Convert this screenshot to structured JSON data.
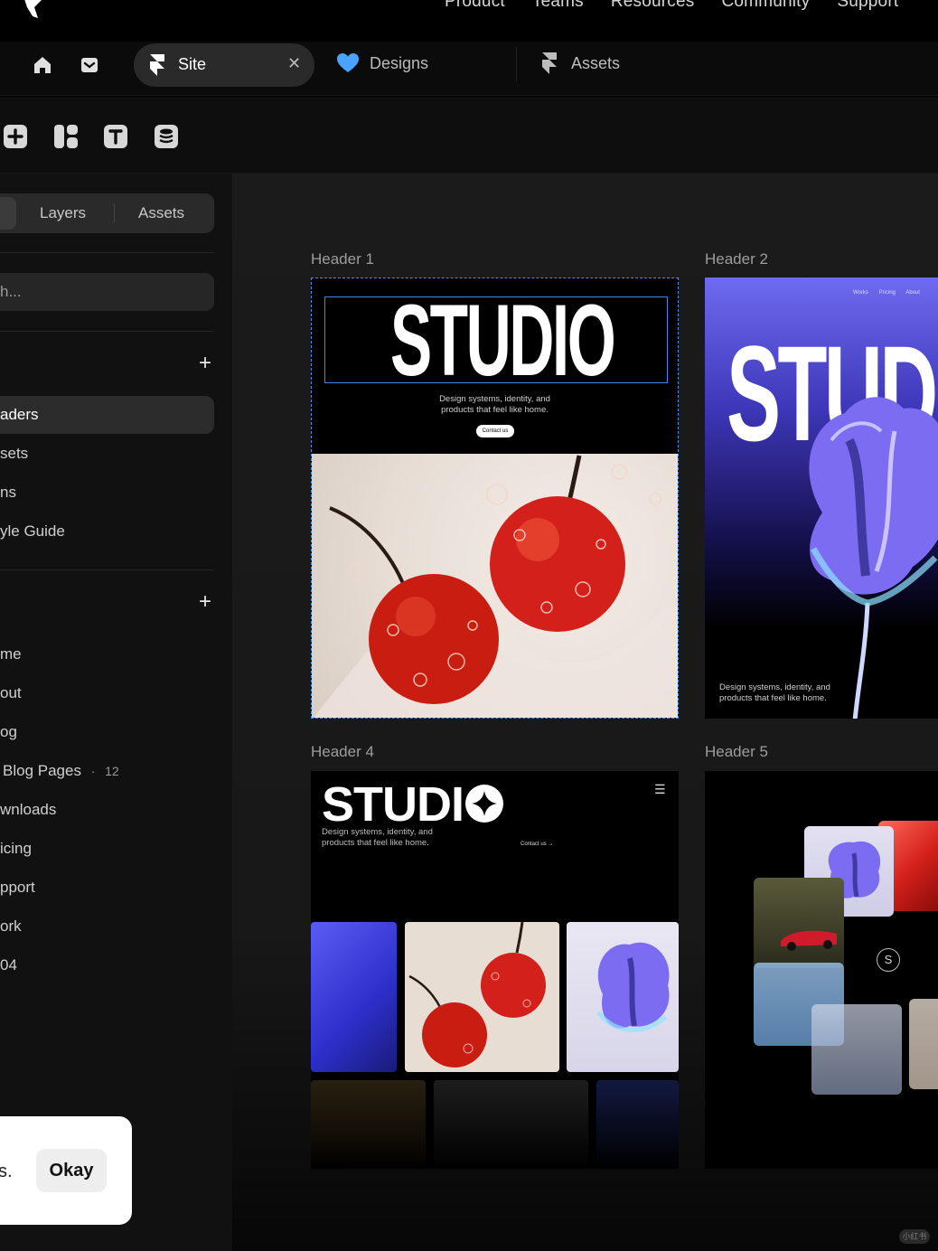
{
  "top_nav": {
    "links": [
      "Product",
      "Teams",
      "Resources",
      "Community",
      "Support"
    ]
  },
  "tabs": {
    "site_label": "Site",
    "designs_label": "Designs",
    "assets_label": "Assets"
  },
  "left_panel": {
    "segments": [
      "Layers",
      "Assets"
    ],
    "search_placeholder": "h...",
    "section1_items": [
      "aders",
      "sets",
      "ns",
      "yle Guide"
    ],
    "section2_items": [
      "me",
      "out",
      "og",
      "Blog Pages",
      "wnloads",
      "icing",
      "pport",
      "ork",
      "04"
    ],
    "blog_pages_count": "12"
  },
  "canvas": {
    "frames": {
      "header1": {
        "label": "Header 1",
        "title": "STUDIO",
        "subtitle_line1": "Design systems, identity, and",
        "subtitle_line2": "products that feel like home.",
        "cta": "Contact us"
      },
      "header2": {
        "label": "Header 2",
        "title": "STUD",
        "mini_links": "Works Pricing About",
        "subtitle_line1": "Design systems, identity, and",
        "subtitle_line2": "products that feel like home."
      },
      "header4": {
        "label": "Header 4",
        "title": "STUDI",
        "subtitle_line1": "Design systems, identity, and",
        "subtitle_line2": "products that feel like home.",
        "contact": "Contact us  →"
      },
      "header5": {
        "label": "Header 5",
        "icon_letter": "S"
      }
    }
  },
  "toast": {
    "message": "s.",
    "button": "Okay"
  },
  "watermark": "小红书",
  "colors": {
    "selection_blue": "#3f86f0",
    "designs_heart": "#4aa3ff",
    "cherry_red": "#d4201a"
  }
}
